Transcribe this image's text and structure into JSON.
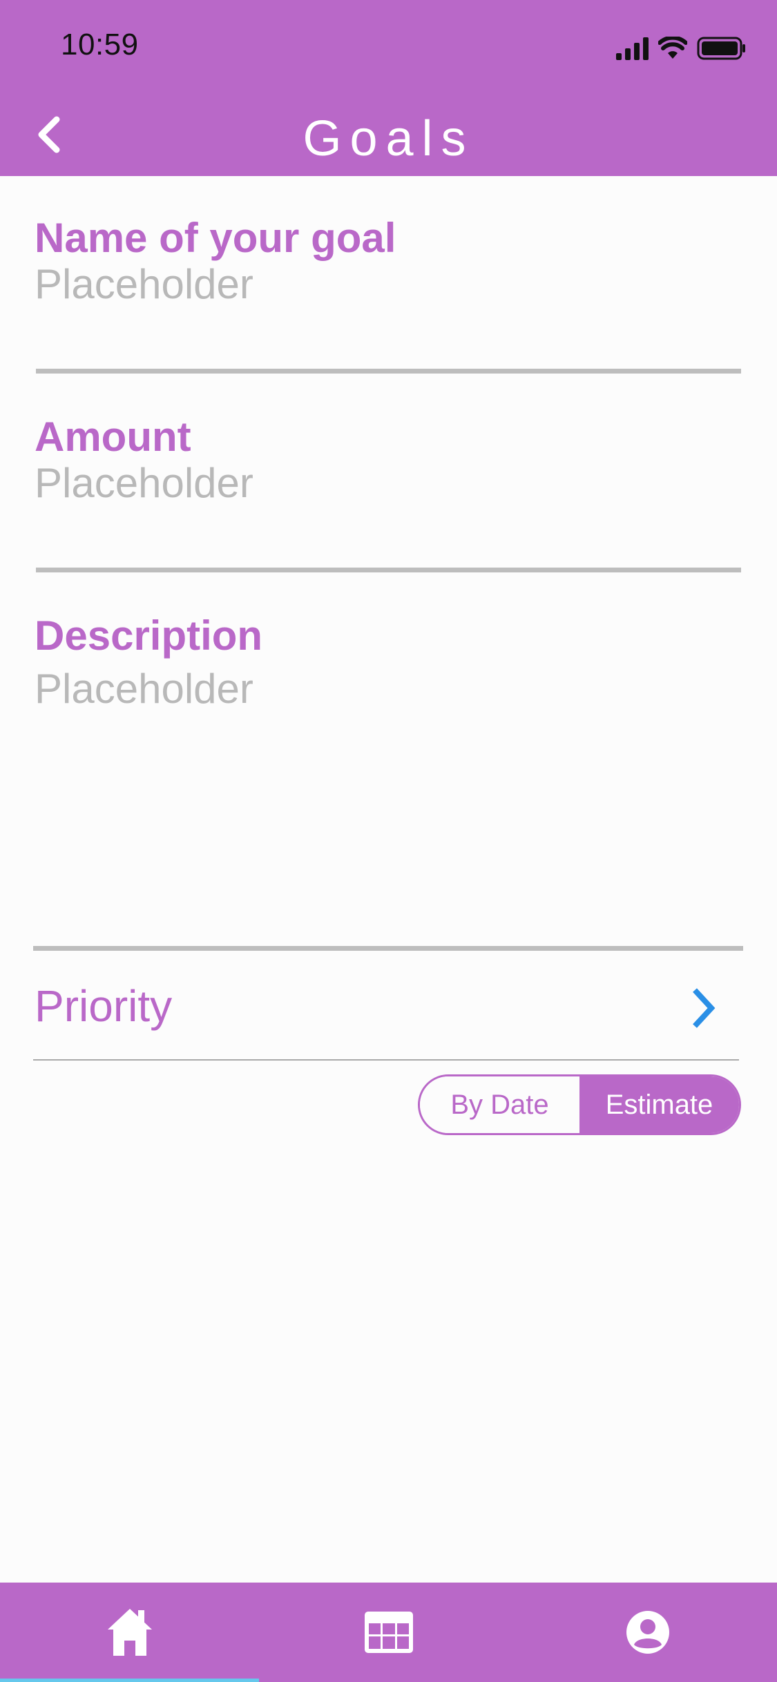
{
  "status_bar": {
    "time": "10:59"
  },
  "header": {
    "title": "Goals",
    "back_icon": "chevron-left-icon"
  },
  "form": {
    "goal_name": {
      "label": "Name of your goal",
      "placeholder": "Placeholder",
      "value": ""
    },
    "amount": {
      "label": "Amount",
      "placeholder": "Placeholder",
      "value": ""
    },
    "description": {
      "label": "Description",
      "placeholder": "Placeholder",
      "value": ""
    },
    "priority": {
      "label": "Priority",
      "icon": "chevron-right-icon"
    },
    "mode_toggle": {
      "options": [
        "By Date",
        "Estimate"
      ],
      "selected": "Estimate"
    }
  },
  "tab_bar": {
    "tabs": [
      {
        "name": "home",
        "icon": "home-icon",
        "selected": true
      },
      {
        "name": "calendar",
        "icon": "calendar-icon",
        "selected": false
      },
      {
        "name": "profile",
        "icon": "user-icon",
        "selected": false
      }
    ]
  },
  "colors": {
    "accent": "#b968c8",
    "placeholder": "#b8b8b8",
    "chevron": "#2a8fe6",
    "tab_indicator": "#66c8ec"
  }
}
